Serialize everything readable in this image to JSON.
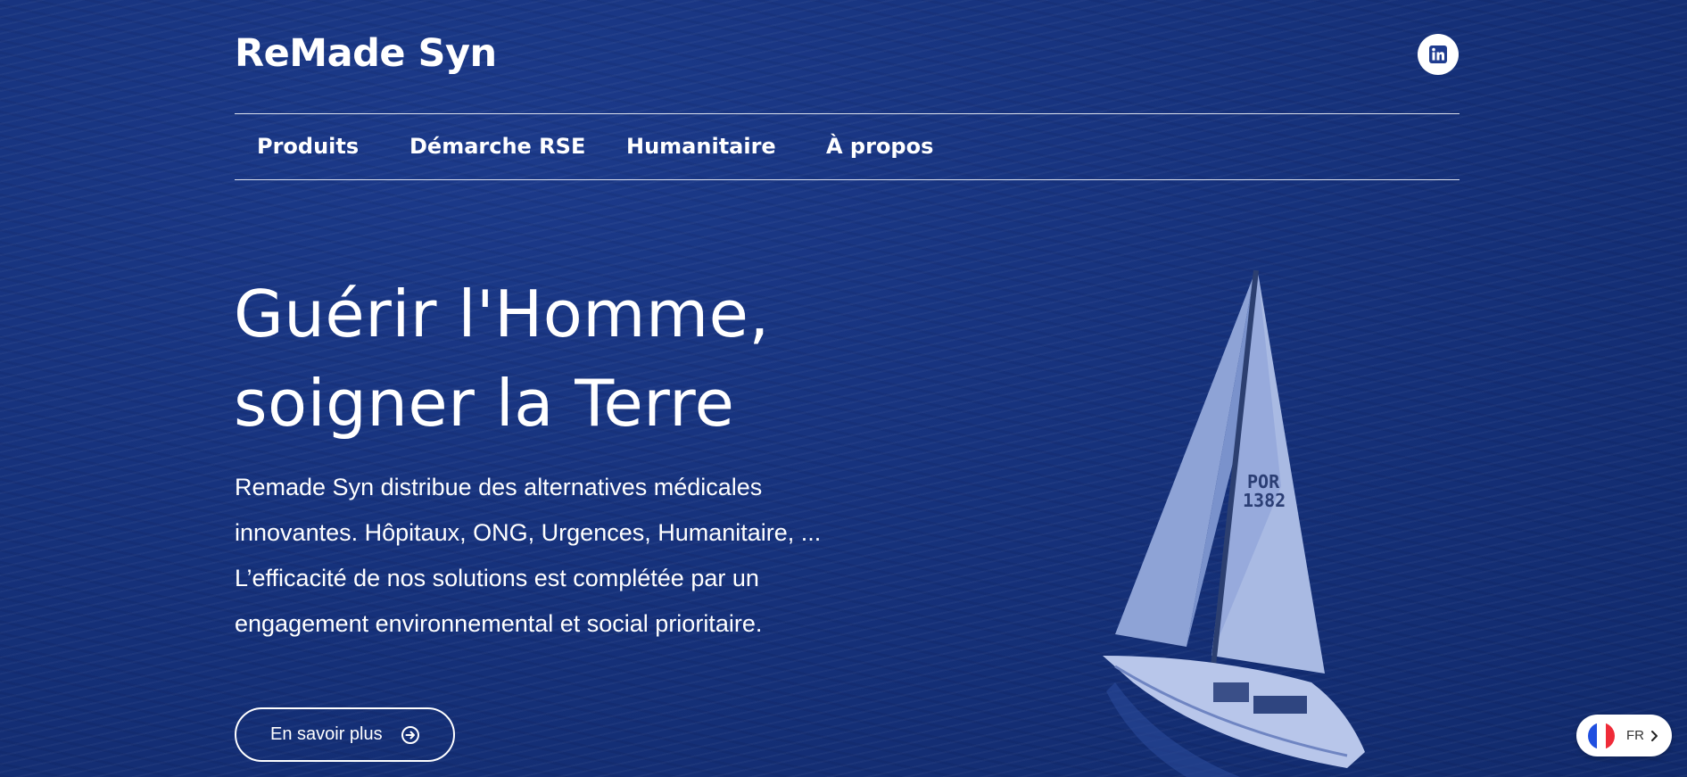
{
  "header": {
    "brand": "ReMade Syn",
    "social_icon": "linkedin-icon"
  },
  "nav": {
    "items": [
      {
        "label": "Produits"
      },
      {
        "label": "Démarche RSE"
      },
      {
        "label": "Humanitaire"
      },
      {
        "label": "À propos"
      }
    ]
  },
  "hero": {
    "title_lines": [
      "Guérir l'Homme,",
      "soigner la Terre"
    ],
    "paragraph_lines": [
      "Remade Syn distribue des alternatives médicales",
      "innovantes. Hôpitaux, ONG, Urgences, Humanitaire, ...",
      "L’efficacité de nos solutions est complétée par un",
      "engagement environnemental et social prioritaire."
    ],
    "cta_label": "En savoir plus",
    "cta_icon": "arrow-right-circle-icon",
    "sail_number": [
      "POR",
      "1382"
    ]
  },
  "language": {
    "code": "FR",
    "flag_icon": "france-flag-icon",
    "chevron_icon": "chevron-right-icon"
  },
  "colors": {
    "background": "#16317b",
    "text": "#ffffff",
    "accent": "#1f3c8f",
    "flag_blue": "#1f4fe0",
    "flag_red": "#ef2b38"
  }
}
